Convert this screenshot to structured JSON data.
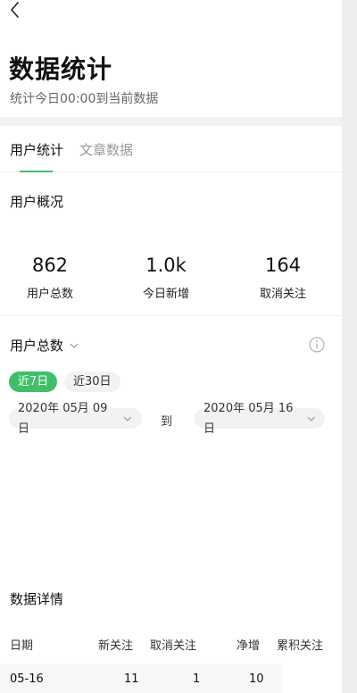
{
  "header": {
    "title": "数据统计",
    "subtitle": "统计今日00:00到当前数据"
  },
  "tabs": [
    {
      "label": "用户统计",
      "active": true
    },
    {
      "label": "文章数据",
      "active": false
    }
  ],
  "overview": {
    "title": "用户概况",
    "stats": [
      {
        "value": "862",
        "label": "用户总数"
      },
      {
        "value": "1.0k",
        "label": "今日新增"
      },
      {
        "value": "164",
        "label": "取消关注"
      }
    ]
  },
  "trend": {
    "metric": "用户总数",
    "ranges": [
      "近7日",
      "近30日"
    ],
    "selected_range": "近7日",
    "start_date": "2020年 05月 09日",
    "to": "到",
    "end_date": "2020年 05月 16日"
  },
  "details": {
    "title": "数据详情",
    "columns": [
      "日期",
      "新关注",
      "取消关注",
      "净增",
      "累积关注"
    ],
    "rows": [
      {
        "date": "05-16",
        "new": "11",
        "unfollow": "1",
        "net": "10",
        "total": ""
      }
    ]
  },
  "colors": {
    "accent": "#3fbf6a"
  }
}
